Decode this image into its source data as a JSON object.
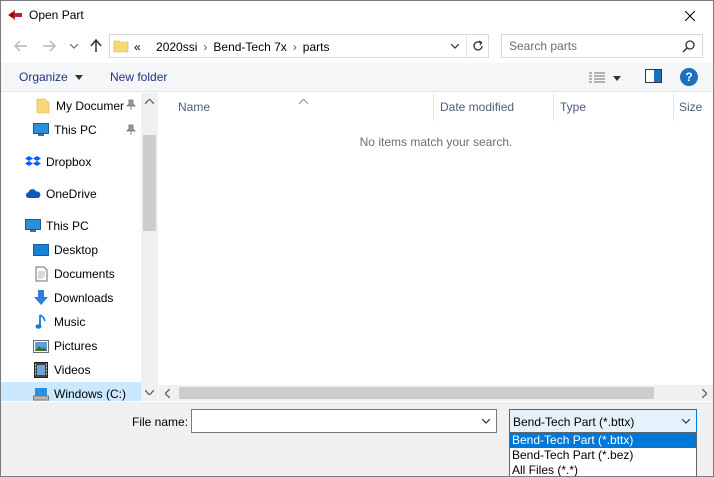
{
  "window": {
    "title": "Open Part",
    "brand_color": "#c0202a"
  },
  "address": {
    "overflow": "«",
    "crumbs": [
      "2020ssi",
      "Bend-Tech 7x",
      "parts"
    ]
  },
  "search": {
    "placeholder": "Search parts",
    "value": ""
  },
  "toolbar": {
    "organize_label": "Organize",
    "new_folder_label": "New folder",
    "help_label": "?"
  },
  "nav": {
    "items": [
      {
        "label": "My Documer",
        "icon": "folder-icon",
        "pinned": true
      },
      {
        "label": "This PC",
        "icon": "computer-icon",
        "pinned": true
      },
      {
        "label": "Dropbox",
        "icon": "dropbox-icon"
      },
      {
        "label": "OneDrive",
        "icon": "cloud-icon"
      },
      {
        "label": "This PC",
        "icon": "computer-icon"
      },
      {
        "label": "Desktop",
        "icon": "desktop-icon"
      },
      {
        "label": "Documents",
        "icon": "documents-icon"
      },
      {
        "label": "Downloads",
        "icon": "download-arrow-icon"
      },
      {
        "label": "Music",
        "icon": "music-note-icon"
      },
      {
        "label": "Pictures",
        "icon": "pictures-icon"
      },
      {
        "label": "Videos",
        "icon": "videos-icon"
      },
      {
        "label": "Windows (C:)",
        "icon": "drive-icon",
        "selected": true
      }
    ]
  },
  "columns": [
    "Name",
    "Date modified",
    "Type",
    "Size"
  ],
  "empty_message": "No items match your search.",
  "filename": {
    "label": "File name:",
    "value": ""
  },
  "filetype": {
    "selected": "Bend-Tech Part (*.bttx)",
    "options": [
      "Bend-Tech Part (*.bttx)",
      "Bend-Tech Part (*.bez)",
      "All Files (*.*)"
    ]
  },
  "colors": {
    "accent": "#0078d7",
    "selection": "#cce8ff",
    "link": "#1e3287",
    "help": "#1f6fc1"
  }
}
